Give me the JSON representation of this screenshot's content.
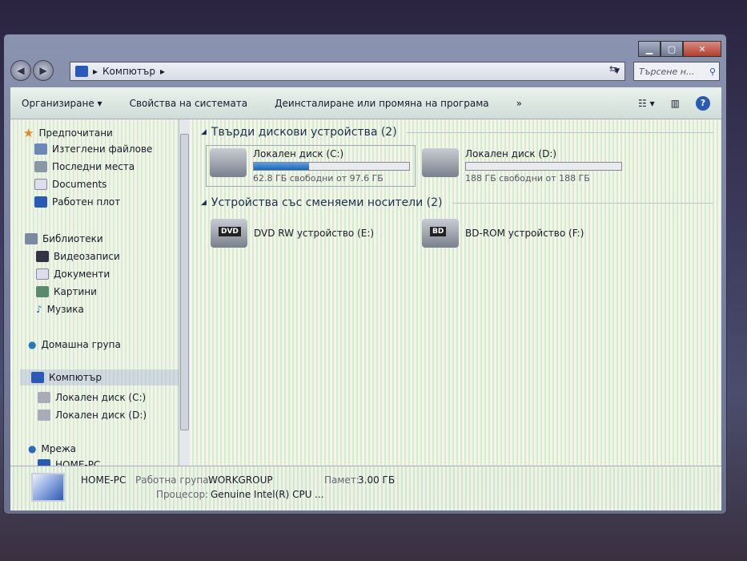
{
  "address": {
    "crumb": "Компютър",
    "search_placeholder": "Търсене н..."
  },
  "toolbar": {
    "organize": "Организиране ▾",
    "system_props": "Свойства на системата",
    "uninstall": "Деинсталиране или промяна на програма",
    "more": "»"
  },
  "nav": {
    "favorites": "Предпочитани",
    "downloads": "Изтеглени файлове",
    "recent": "Последни места",
    "documents": "Documents",
    "desktop": "Работен плот",
    "libraries": "Библиотеки",
    "videos": "Видеозаписи",
    "docs_lib": "Документи",
    "pictures": "Картини",
    "music": "Музика",
    "homegroup": "Домашна група",
    "computer": "Компютър",
    "disk_c": "Локален диск (C:)",
    "disk_d": "Локален диск (D:)",
    "network": "Мрежа",
    "home_pc": "HOME-PC"
  },
  "content": {
    "hdd_group": "Твърди дискови устройства (2)",
    "removable_group": "Устройства със сменяеми носители (2)",
    "drives": [
      {
        "name": "Локален диск (C:)",
        "free": "62.8 ГБ свободни от 97.6 ГБ",
        "used_percent": 35.7
      },
      {
        "name": "Локален диск (D:)",
        "free": "188 ГБ свободни от 188 ГБ",
        "used_percent": 0
      }
    ],
    "removable": [
      {
        "name": "DVD RW устройство (E:)",
        "badge": "DVD"
      },
      {
        "name": "BD-ROM устройство (F:)",
        "badge": "BD"
      }
    ]
  },
  "details": {
    "name": "HOME-PC",
    "workgroup_label": "Работна група:",
    "workgroup": "WORKGROUP",
    "memory_label": "Памет:",
    "memory": "3.00 ГБ",
    "cpu_label": "Процесор:",
    "cpu": "Genuine Intel(R) CPU",
    "ellipsis": "..."
  }
}
